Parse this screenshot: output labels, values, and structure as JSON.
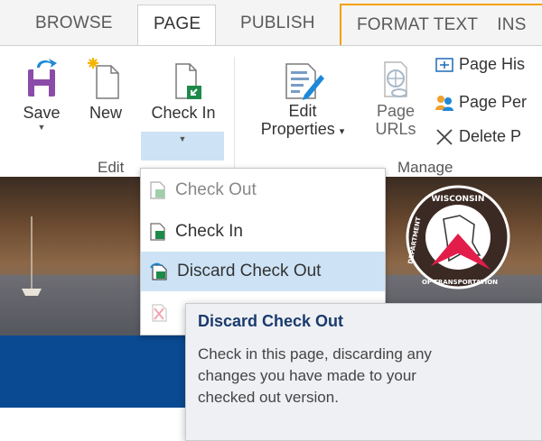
{
  "tabs": [
    {
      "label": "BROWSE"
    },
    {
      "label": "PAGE"
    },
    {
      "label": "PUBLISH"
    },
    {
      "label": "FORMAT TEXT"
    },
    {
      "label": "INS"
    }
  ],
  "ribbon": {
    "save_label": "Save",
    "new_label": "New",
    "checkin_label": "Check In",
    "edit_properties_line1": "Edit",
    "edit_properties_line2": "Properties",
    "page_urls_line1": "Page",
    "page_urls_line2": "URLs",
    "page_history_label": "Page His",
    "page_permissions_label": "Page Per",
    "delete_page_label": "Delete P",
    "edit_group_label": "Edit",
    "manage_group_label": "Manage"
  },
  "dropdown": {
    "items": [
      {
        "label": "Check Out",
        "state": "disabled"
      },
      {
        "label": "Check In",
        "state": "enabled"
      },
      {
        "label": "Discard Check Out",
        "state": "selected"
      },
      {
        "label": "",
        "state": "disabled"
      }
    ]
  },
  "tooltip": {
    "title": "Discard Check Out",
    "line1": "Check in this page, discarding any",
    "line2": "changes you have made to your",
    "line3": "checked out version."
  },
  "banner": {
    "seal_top": "WISCONSIN",
    "seal_left": "DEPARTMENT",
    "seal_bottom": "OF TRANSPORTATION"
  },
  "colors": {
    "accent_orange": "#f4a000",
    "selection_blue": "#cde3f5",
    "band_blue": "#0a4a93",
    "tooltip_title": "#1a3b6d"
  }
}
